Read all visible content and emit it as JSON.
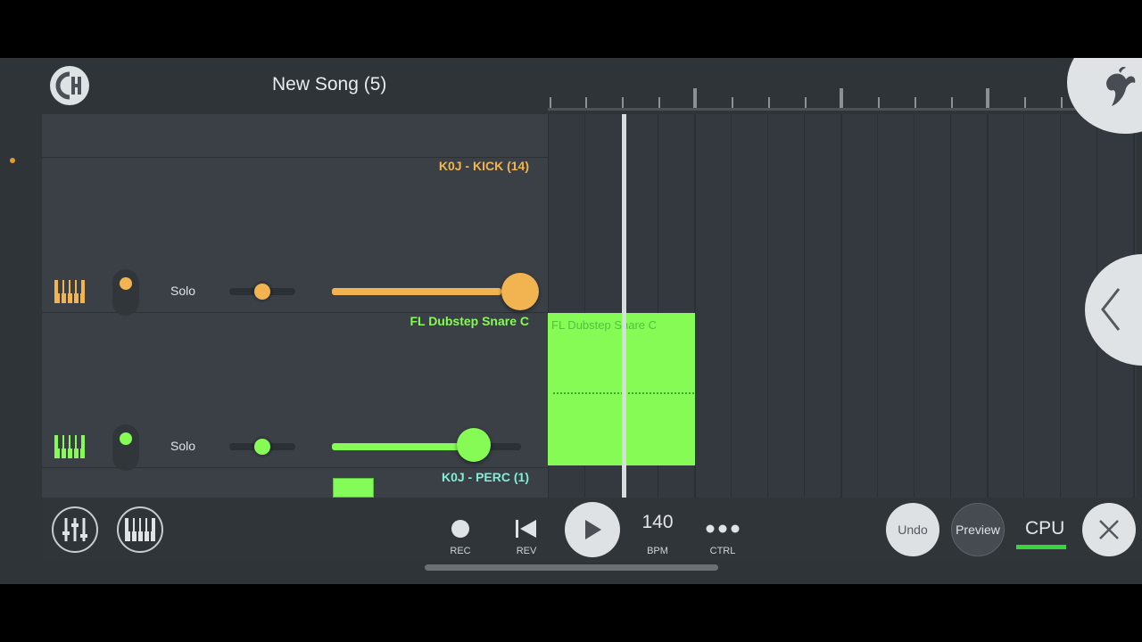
{
  "app": {
    "song_title": "New Song (5)",
    "logo_icon": "fl-studio-logo-icon",
    "fl_menu_icon": "fruit-logo-icon"
  },
  "colors": {
    "kick": "#f2b450",
    "snare": "#86fb55",
    "perc": "#7ff0d4",
    "cpu_meter": "#39d53d"
  },
  "channels": [
    {
      "name": "K0J - KICK (14)",
      "solo_label": "Solo",
      "color": "#f2b450",
      "volume": 1.0,
      "pan": 0.5
    },
    {
      "name": "FL Dubstep Snare C",
      "solo_label": "Solo",
      "color": "#86fb55",
      "volume": 0.77,
      "pan": 0.5
    },
    {
      "name": "K0J - PERC (1)",
      "color": "#7ff0d4"
    }
  ],
  "playlist": {
    "clip_label": "FL Dubstep Snare C"
  },
  "transport": {
    "rec_label": "REC",
    "rev_label": "REV",
    "bpm_value": "140",
    "bpm_label": "BPM",
    "ctrl_label": "CTRL",
    "undo_label": "Undo",
    "preview_label": "Preview",
    "cpu_label": "CPU",
    "cpu_load": 1.0
  }
}
